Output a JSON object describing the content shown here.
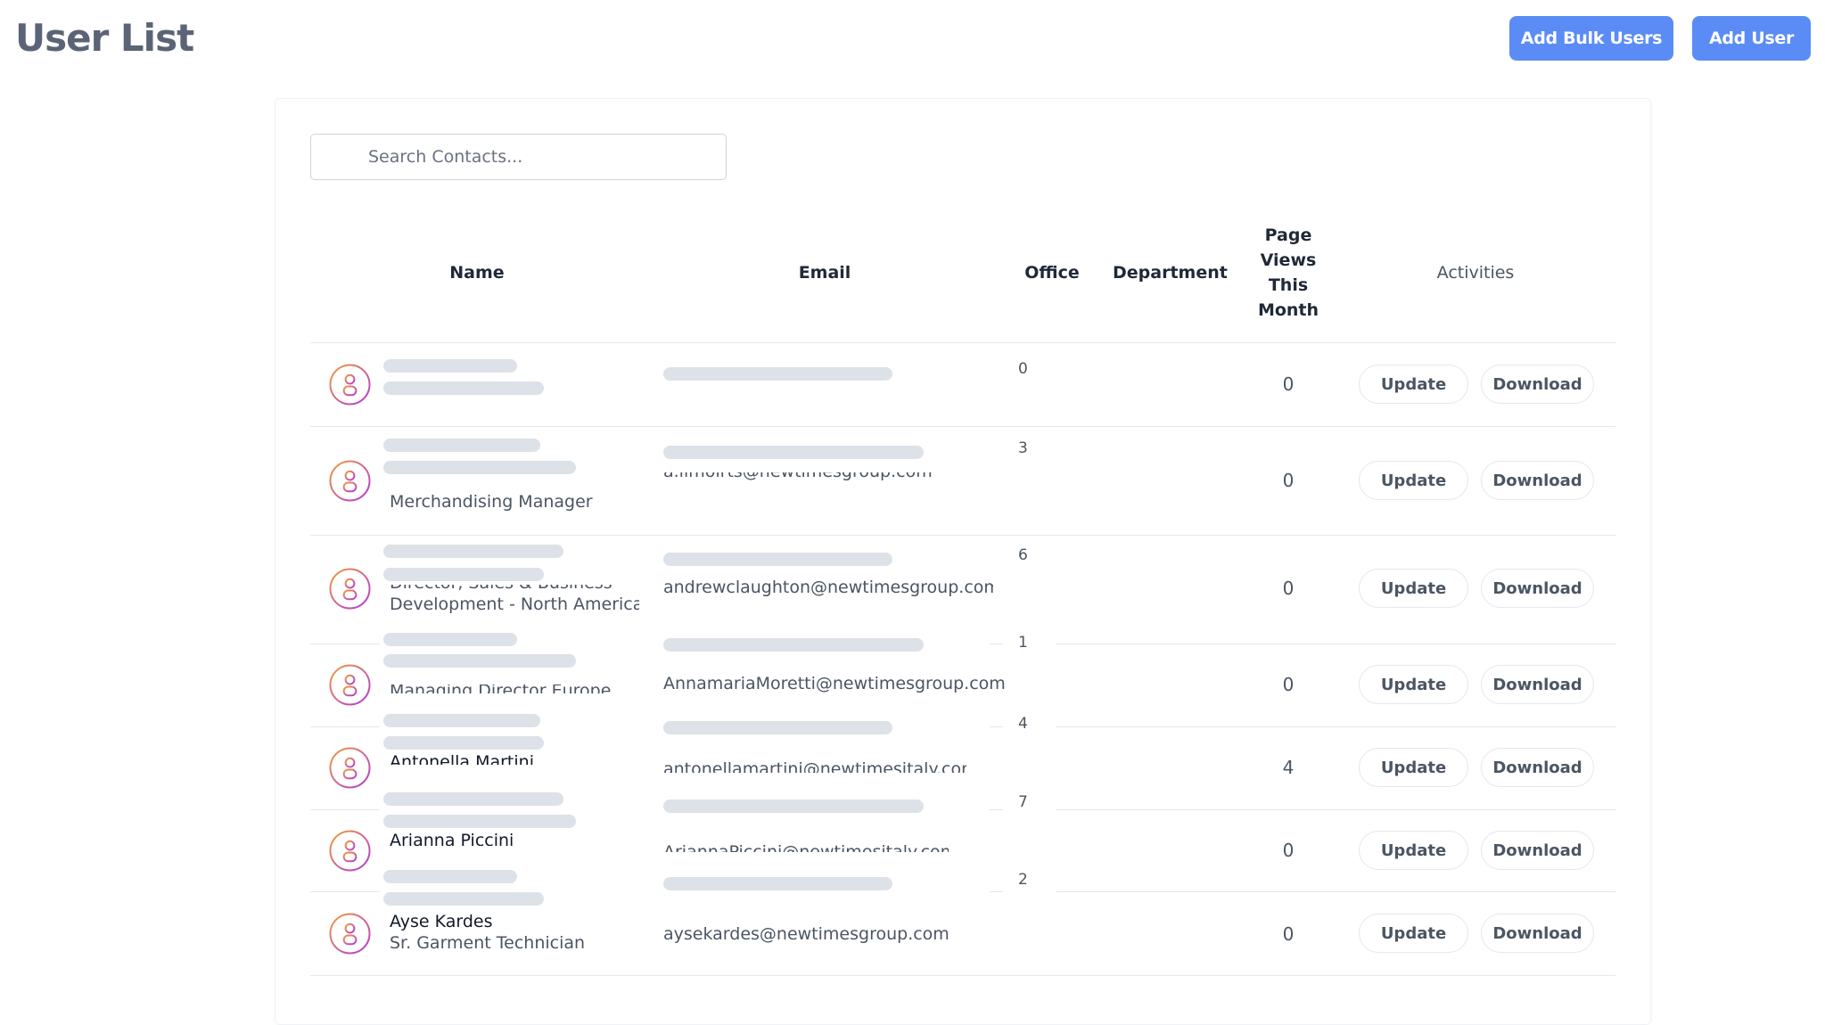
{
  "header": {
    "title": "User List",
    "bulk_label": "Add Bulk Users",
    "add_label": "Add User"
  },
  "search": {
    "placeholder": "Search Contacts..."
  },
  "table": {
    "columns": {
      "name": "Name",
      "email": "Email",
      "office": "Office",
      "department": "Department",
      "views_1": "Page",
      "views_2": "Views",
      "views_3": "This",
      "views_4": "Month",
      "activities": "Activities"
    },
    "rows": [
      {
        "office": "0",
        "views": "0",
        "update": "Update",
        "download": "Download"
      },
      {
        "role": "Merchandising Manager",
        "email_partial": "a.limoirts@newtimesgroup.com",
        "office": "3",
        "views": "0",
        "update": "Update",
        "download": "Download"
      },
      {
        "role_partial_1": "Director, Sales & Business",
        "role_partial_2": "Development - North America",
        "email_partial": "andrewclaughton@newtimesgroup.com",
        "office": "6",
        "views": "0",
        "update": "Update",
        "download": "Download"
      },
      {
        "role_partial": "Managing Director Europe",
        "email": "AnnamariaMoretti@newtimesgroup.com",
        "office": "1",
        "views": "0",
        "update": "Update",
        "download": "Download"
      },
      {
        "name_partial": "Antonella Martini",
        "email_partial": "antonellamartini@newtimesitaly.com",
        "office": "4",
        "views": "4",
        "update": "Update",
        "download": "Download"
      },
      {
        "name_partial": "Arianna Piccini",
        "email_partial": "AriannaPiccini@newtimesitaly.com",
        "office": "7",
        "views": "0",
        "update": "Update",
        "download": "Download"
      },
      {
        "name": "Ayse Kardes",
        "role": "Sr. Garment Technician",
        "email": "aysekardes@newtimesgroup.com",
        "office": "2",
        "views": "0",
        "update": "Update",
        "download": "Download"
      }
    ]
  },
  "colors": {
    "primary": "#5b8cf5",
    "title": "#5b6477",
    "skeleton": "#dde1e8",
    "avatar_gradient_start": "#f08a3c",
    "avatar_gradient_end": "#b23bd6"
  }
}
